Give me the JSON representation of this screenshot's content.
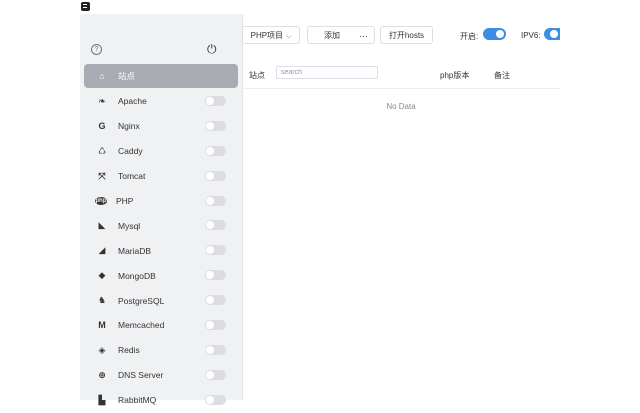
{
  "sidebar": {
    "items": [
      {
        "label": "站点",
        "icon": "home-icon",
        "glyph": "⌂",
        "active": true
      },
      {
        "label": "Apache",
        "icon": "apache-feather-icon",
        "glyph": "❧"
      },
      {
        "label": "Nginx",
        "icon": "nginx-icon",
        "glyph": "G"
      },
      {
        "label": "Caddy",
        "icon": "caddy-icon",
        "glyph": "♺"
      },
      {
        "label": "Tomcat",
        "icon": "tomcat-icon",
        "glyph": "⤧"
      },
      {
        "label": "PHP",
        "icon": "php-icon",
        "glyph": "php"
      },
      {
        "label": "Mysql",
        "icon": "mysql-dolphin-icon",
        "glyph": "◣"
      },
      {
        "label": "MariaDB",
        "icon": "mariadb-seal-icon",
        "glyph": "◢"
      },
      {
        "label": "MongoDB",
        "icon": "mongodb-leaf-icon",
        "glyph": "◆"
      },
      {
        "label": "PostgreSQL",
        "icon": "postgresql-elephant-icon",
        "glyph": "♞"
      },
      {
        "label": "Memcached",
        "icon": "memcached-icon",
        "glyph": "M"
      },
      {
        "label": "Redis",
        "icon": "redis-icon",
        "glyph": "◈"
      },
      {
        "label": "DNS Server",
        "icon": "dns-server-icon",
        "glyph": "⊕"
      },
      {
        "label": "RabbitMQ",
        "icon": "rabbitmq-icon",
        "glyph": "▙"
      }
    ]
  },
  "toolbar": {
    "php_project_label": "PHP项目",
    "add_label": "添加",
    "more_label": "···",
    "open_hosts_label": "打开hosts",
    "enable_label": "开启:",
    "ipv6_label": "IPV6:"
  },
  "table": {
    "site_label": "站点",
    "search_placeholder": "search",
    "php_version_label": "php版本",
    "note_label": "备注",
    "empty_text": "No Data"
  },
  "colors": {
    "accent": "#3a8ee6",
    "active_item": "#a9abb2"
  }
}
